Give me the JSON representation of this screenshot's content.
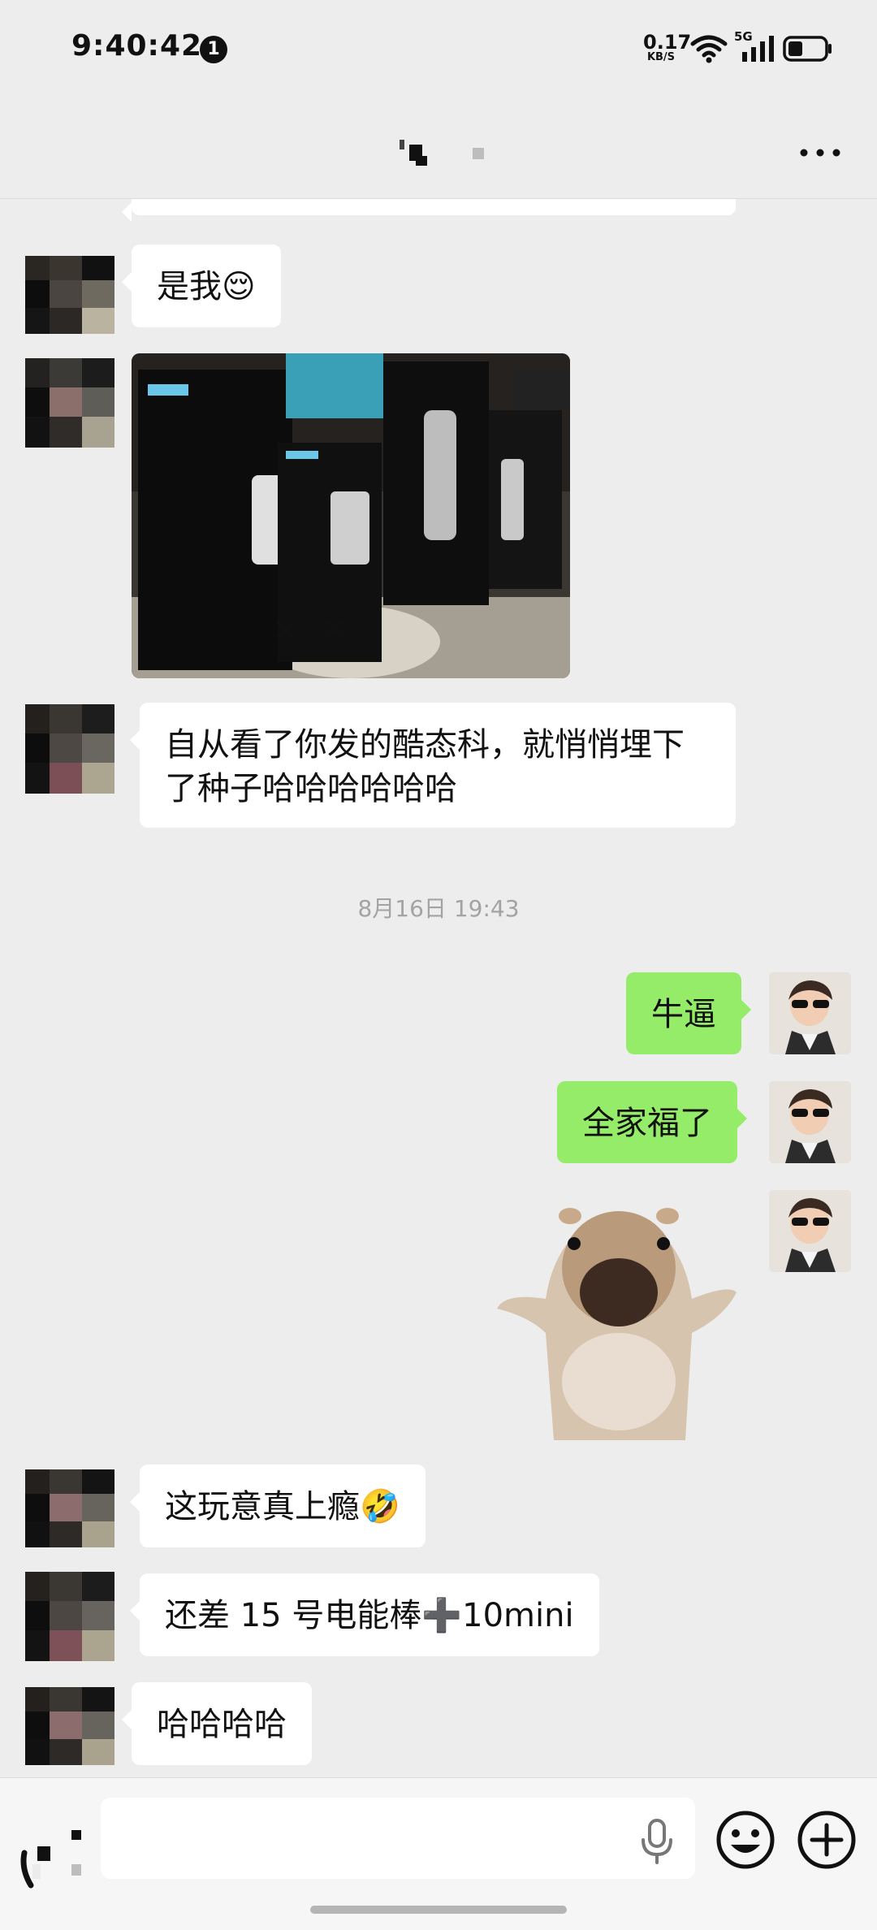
{
  "status_bar": {
    "time": "9:40:42",
    "notification_count": "1",
    "net_speed_value": "0.17",
    "net_speed_unit": "KB/S",
    "network_type": "5G",
    "icons": [
      "wifi-icon",
      "cellular-signal-icon",
      "battery-icon"
    ]
  },
  "nav": {
    "more_icon": "more-dots-icon"
  },
  "messages": [
    {
      "side": "in",
      "type": "text",
      "text": "是我😌"
    },
    {
      "side": "in",
      "type": "image",
      "caption": "CUKTECH 充电宝/充电器包装盒照片"
    },
    {
      "side": "in",
      "type": "text",
      "text": "自从看了你发的酷态科，就悄悄埋下了种子哈哈哈哈哈哈"
    },
    {
      "type": "timestamp",
      "text": "8月16日 19:43"
    },
    {
      "side": "out",
      "type": "text",
      "text": "牛逼"
    },
    {
      "side": "out",
      "type": "text",
      "text": "全家福了"
    },
    {
      "side": "out",
      "type": "sticker",
      "sticker": "hamster-sticker"
    },
    {
      "side": "in",
      "type": "text",
      "text": "这玩意真上瘾🤣"
    },
    {
      "side": "in",
      "type": "text",
      "text": "还差 15 号电能棒➕10mini"
    },
    {
      "side": "in",
      "type": "text",
      "text": "哈哈哈哈"
    }
  ],
  "input_bar": {
    "placeholder": "",
    "icons": [
      "voice-toggle-icon",
      "microphone-icon",
      "emoji-icon",
      "plus-icon"
    ]
  },
  "colors": {
    "background": "#ededed",
    "incoming_bubble": "#ffffff",
    "outgoing_bubble": "#95ec69",
    "timestamp_text": "#a3a3a3"
  }
}
